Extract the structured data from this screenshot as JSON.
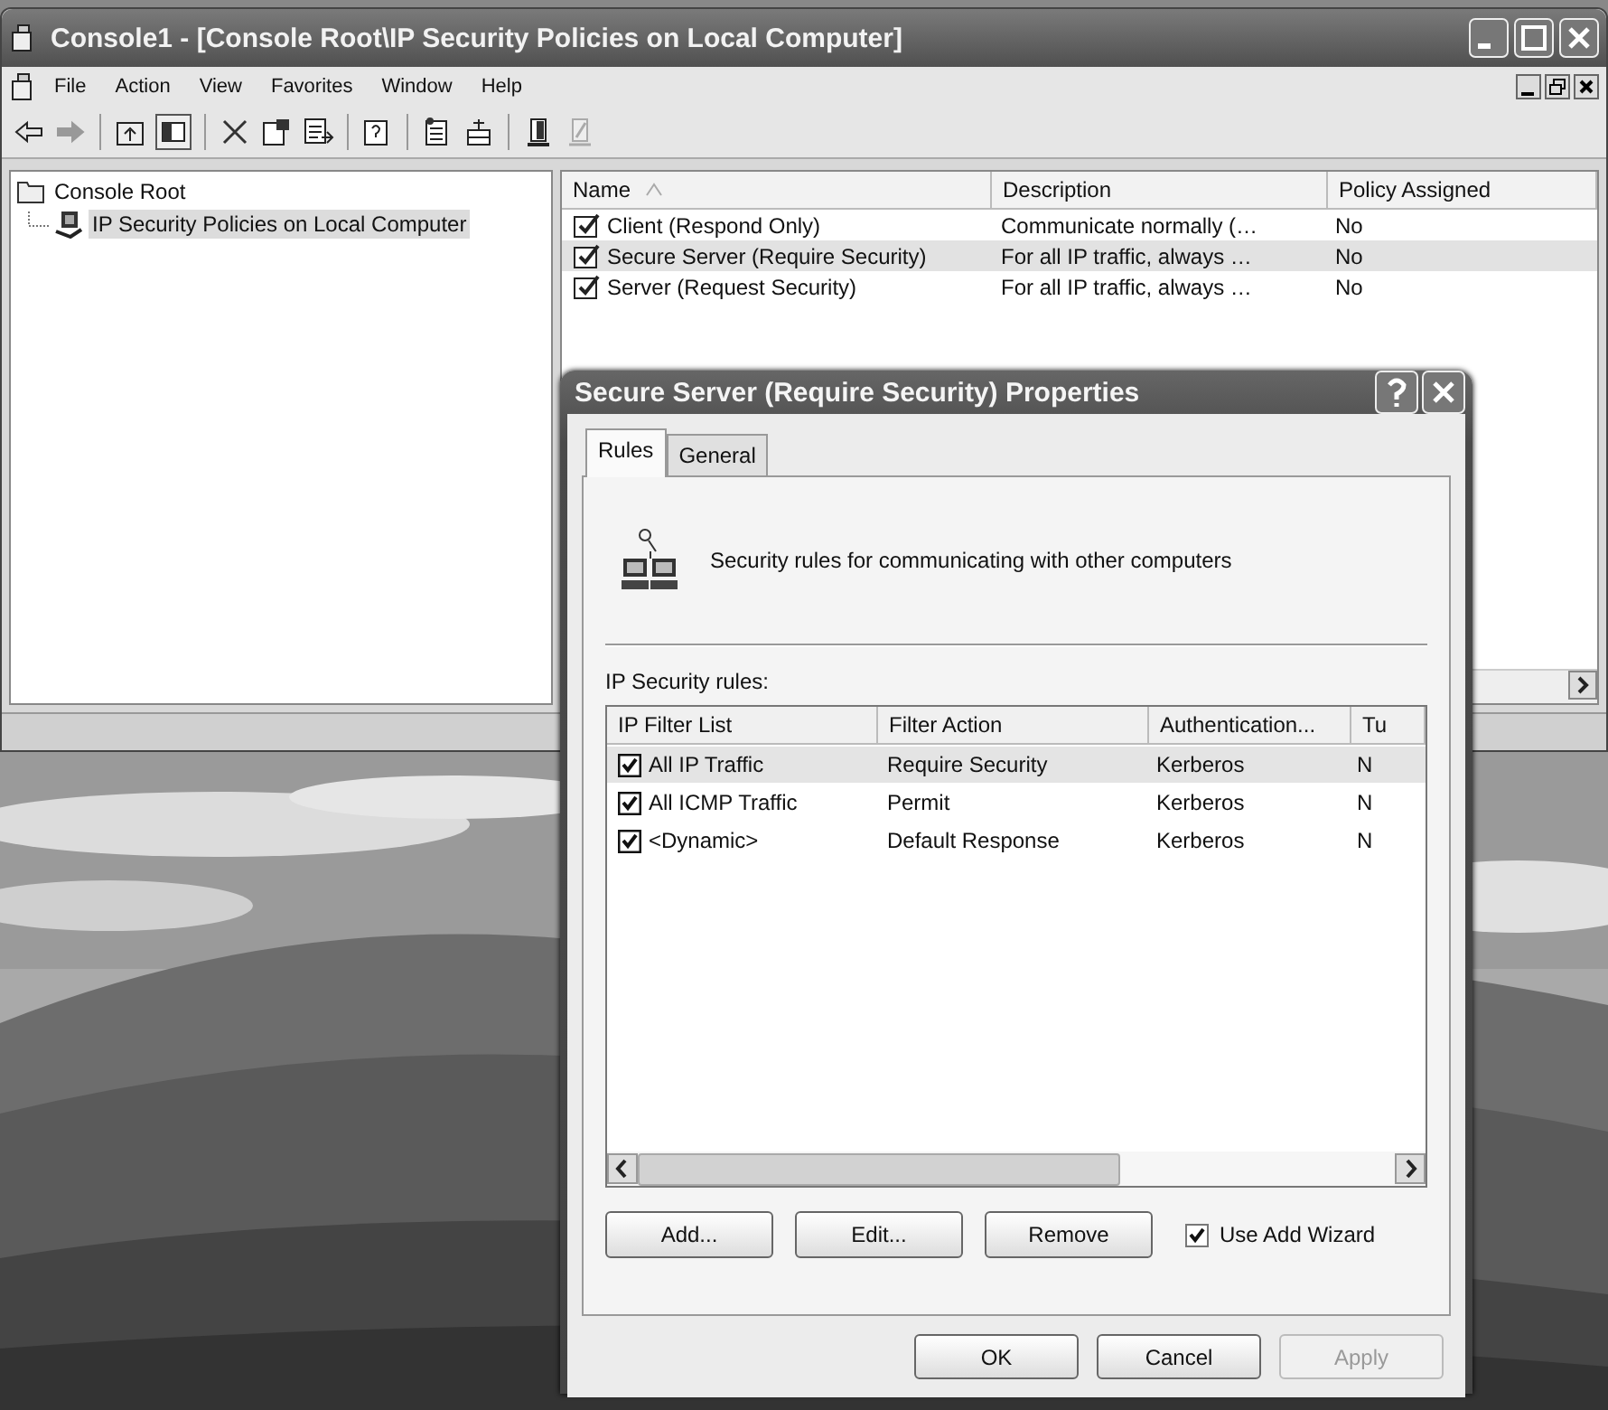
{
  "window": {
    "title": "Console1 - [Console Root\\IP Security Policies on Local Computer]"
  },
  "menu": [
    "File",
    "Action",
    "View",
    "Favorites",
    "Window",
    "Help"
  ],
  "tree": [
    {
      "label": "Console Root",
      "selected": false,
      "children": [
        {
          "label": "IP Security Policies on Local Computer",
          "selected": true
        }
      ]
    }
  ],
  "policy_list": {
    "columns": [
      "Name",
      "Description",
      "Policy Assigned"
    ],
    "rows": [
      {
        "name": "Client (Respond Only)",
        "description": "Communicate normally (…",
        "assigned": "No",
        "selected": false
      },
      {
        "name": "Secure Server (Require Security)",
        "description": "For all IP traffic, always …",
        "assigned": "No",
        "selected": true
      },
      {
        "name": "Server (Request Security)",
        "description": "For all IP traffic, always …",
        "assigned": "No",
        "selected": false
      }
    ]
  },
  "dialog": {
    "title": "Secure Server (Require Security) Properties",
    "tabs": [
      {
        "label": "Rules",
        "selected": true
      },
      {
        "label": "General",
        "selected": false
      }
    ],
    "description": "Security rules for communicating with other computers",
    "rules_label": "IP Security rules:",
    "rules": {
      "columns": [
        "IP Filter List",
        "Filter Action",
        "Authentication...",
        "Tu"
      ],
      "rows": [
        {
          "filter": "All IP Traffic",
          "action": "Require Security",
          "auth": "Kerberos",
          "column_4": "N",
          "checked": true,
          "selected": true
        },
        {
          "filter": "All ICMP Traffic",
          "action": "Permit",
          "auth": "Kerberos",
          "column_4": "N",
          "checked": true,
          "selected": false
        },
        {
          "filter": "<Dynamic>",
          "action": "Default Response",
          "auth": "Kerberos",
          "column_4": "N",
          "checked": true,
          "selected": false
        }
      ]
    },
    "rule_buttons": [
      "Add...",
      "Edit...",
      "Remove"
    ],
    "use_add_wizard": {
      "label": "Use Add Wizard",
      "checked": true
    },
    "footer_buttons": [
      {
        "label": "OK",
        "disabled": false
      },
      {
        "label": "Cancel",
        "disabled": false
      },
      {
        "label": "Apply",
        "disabled": true
      }
    ]
  }
}
